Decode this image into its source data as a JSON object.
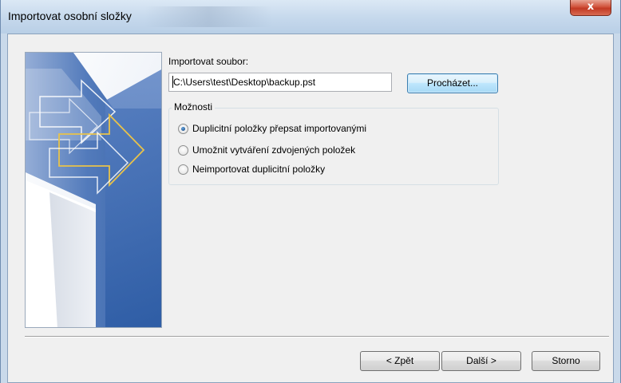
{
  "window": {
    "title": "Importovat osobní složky",
    "close_glyph": "x",
    "close_icon": "close-icon"
  },
  "form": {
    "file_label": "Importovat soubor:",
    "file_path": "C:\\Users\\test\\Desktop\\backup.pst",
    "browse_label": "Procházet..."
  },
  "options": {
    "group_label": "Možnosti",
    "items": [
      {
        "label": "Duplicitní položky přepsat importovanými",
        "checked": true
      },
      {
        "label": "Umožnit vytváření zdvojených položek",
        "checked": false
      },
      {
        "label": "Neimportovat duplicitní položky",
        "checked": false
      }
    ]
  },
  "footer": {
    "back_label": "< Zpět",
    "next_label": "Další >",
    "cancel_label": "Storno"
  },
  "colors": {
    "title_bar": "#c5d8ec",
    "close_button": "#c94a33",
    "graphic_blue": "#3d67ad",
    "arrow_gold": "#e8c24a"
  }
}
